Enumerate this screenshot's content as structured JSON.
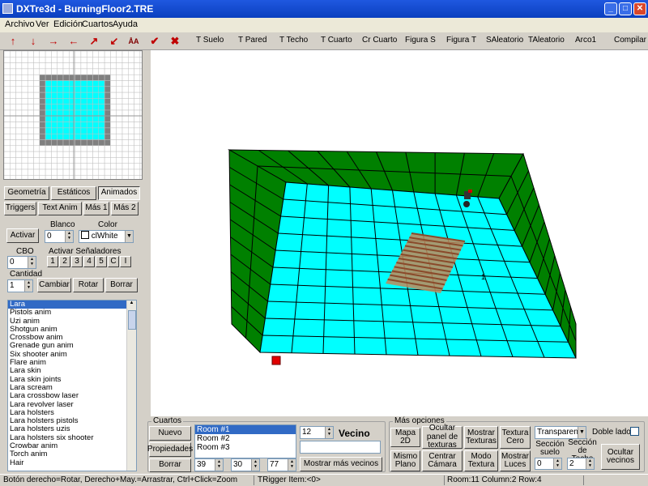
{
  "window": {
    "title": "DXTre3d - BurningFloor2.TRE"
  },
  "menu": [
    "Archivo",
    "Ver",
    "Edición",
    "Cuartos",
    "Ayuda"
  ],
  "toolbar": {
    "icons": [
      "arrow-up-icon",
      "arrow-down-icon",
      "arrow-right-icon",
      "arrow-left-icon",
      "arrow-diag-up-right-icon",
      "arrow-diag-down-left-icon",
      "aa-icon",
      "check-icon",
      "cross-icon"
    ],
    "labels": [
      "T Suelo",
      "T Pared",
      "T Techo",
      "T Cuarto",
      "Cr Cuarto",
      "Figura S",
      "Figura T",
      "SAleatorio",
      "TAleatorio",
      "Arco1",
      "Compilar"
    ]
  },
  "left": {
    "tabs": [
      "Geometría",
      "Estáticos",
      "Animados"
    ],
    "active_tab": "Animados",
    "subtabs": [
      "Triggers",
      "Text Anim",
      "Más 1",
      "Más 2"
    ],
    "activar_label": "Activar",
    "blanco_label": "Blanco",
    "blanco_value": "0",
    "color_label": "Color",
    "color_value": "clWhite",
    "cbo_label": "CBO",
    "cbo_value": "0",
    "senaladores_label": "Activar Señaladores",
    "senaladores": [
      "1",
      "2",
      "3",
      "4",
      "5",
      "C",
      "I"
    ],
    "cantidad_label": "Cantidad",
    "cantidad_value": "1",
    "cambiar_label": "Cambiar",
    "rotar_label": "Rotar",
    "borrar_label": "Borrar",
    "list_items": [
      "Lara",
      "Pistols anim",
      "Uzi anim",
      "Shotgun anim",
      "Crossbow anim",
      "Grenade gun anim",
      "Six shooter anim",
      "Flare anim",
      "Lara skin",
      "Lara skin joints",
      "Lara scream",
      "Lara crossbow laser",
      "Lara revolver laser",
      "Lara holsters",
      "Lara holsters pistols",
      "Lara holsters uzis",
      "Lara holsters six shooter",
      "Crowbar anim",
      "Torch anim",
      "Hair"
    ],
    "selected_item": "Lara"
  },
  "viewport": {
    "floor_color": "#00ffff",
    "wall_color": "#008000",
    "label_1": "1"
  },
  "cuartos": {
    "title": "Cuartos",
    "nuevo": "Nuevo",
    "propiedades": "Propiedades",
    "borrar": "Borrar",
    "rooms": [
      "Room #1",
      "Room #2",
      "Room #3"
    ],
    "selected_room": "Room #1",
    "vecino_value": "12",
    "vecino_label": "Vecino",
    "x": "39",
    "y": "30",
    "z": "77",
    "mostrar_vecinos": "Mostrar más vecinos"
  },
  "opciones": {
    "title": "Más opciones",
    "mapa2d": "Mapa 2D",
    "ocultar_panel": "Ocultar panel de texturas",
    "mostrar_texturas": "Mostrar Texturas",
    "textura_cero": "Textura Cero",
    "transparent": "Transparent",
    "doble_lado": "Doble lado",
    "mismo_plano": "Mismo Plano",
    "centrar_camara": "Centrar Cámara",
    "modo_textura": "Modo Textura",
    "mostrar_luces": "Mostrar Luces",
    "seccion_suelo": "Sección suelo",
    "seccion_suelo_value": "0",
    "seccion_techo": "Sección de Techo",
    "seccion_techo_value": "2",
    "ocultar_vecinos": "Ocultar vecinos"
  },
  "status": {
    "hint": "Botón derecho=Rotar, Derecho+May.=Arrastrar, Ctrl+Click=Zoom",
    "trigger": "TRigger Item:<0>",
    "room": "Room:11 Column:2 Row:4"
  }
}
